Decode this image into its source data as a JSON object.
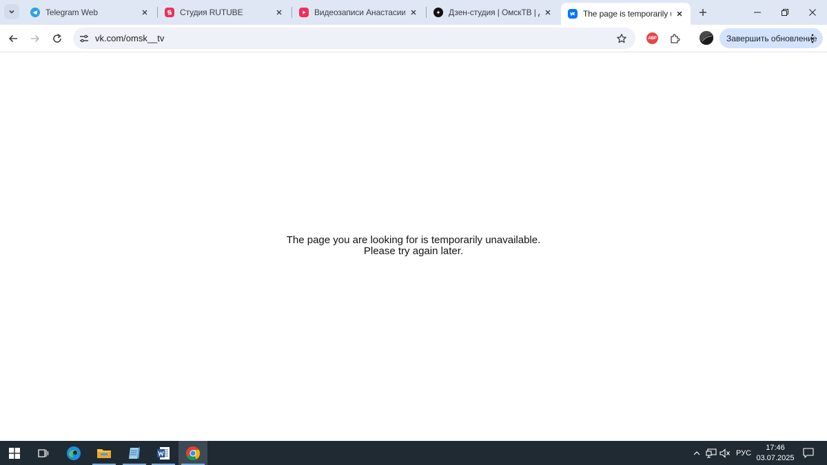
{
  "browser": {
    "tabs": [
      {
        "title": "Telegram Web",
        "icon": "telegram-icon",
        "color": "#2aa3df",
        "active": false
      },
      {
        "title": "Студия RUTUBE",
        "icon": "rutube-icon",
        "color": "#e8345b",
        "active": false
      },
      {
        "title": "Видеозаписи Анастасии Са",
        "icon": "video-icon",
        "color": "#f0305a",
        "active": false
      },
      {
        "title": "Дзен-студия | ОмскТВ | Дзе",
        "icon": "dzen-icon",
        "color": "#111111",
        "active": false
      },
      {
        "title": "The page is temporarily una",
        "icon": "vk-icon",
        "color": "#0077ff",
        "active": true
      }
    ],
    "address": "vk.com/omsk__tv",
    "extension_badge": "ABP",
    "update_button": "Завершить обновление"
  },
  "page": {
    "message_line1": "The page you are looking for is temporarily unavailable.",
    "message_line2": "Please try again later."
  },
  "taskbar": {
    "language": "РУС",
    "time": "17:46",
    "date": "03.07.2025"
  },
  "colors": {
    "tabstrip_bg": "#dfe7f4",
    "omnibox_bg": "#eef1f8",
    "update_button_bg": "#d3e3fd",
    "taskbar_bg": "#1f2a33"
  }
}
